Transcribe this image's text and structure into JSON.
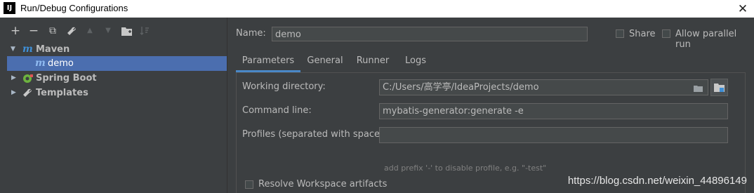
{
  "window": {
    "title": "Run/Debug Configurations",
    "app_icon": "IJ",
    "close": "✕"
  },
  "toolbar": {
    "add": "+",
    "remove": "−",
    "copy": "⧉",
    "edit": "🔧",
    "up": "▲",
    "down": "▼",
    "folder": "▣",
    "sort": "↓"
  },
  "tree": {
    "maven": {
      "label": "Maven",
      "icon": "m"
    },
    "demo": {
      "label": "demo",
      "icon": "m"
    },
    "spring_boot": {
      "label": "Spring Boot"
    },
    "templates": {
      "label": "Templates"
    }
  },
  "name": {
    "label": "Name:",
    "value": "demo"
  },
  "options": {
    "share": "Share",
    "allow_parallel": "Allow parallel run"
  },
  "tabs": [
    "Parameters",
    "General",
    "Runner",
    "Logs"
  ],
  "params": {
    "working_dir": {
      "label": "Working directory:",
      "value": "C:/Users/高学亭/IdeaProjects/demo"
    },
    "command_line": {
      "label": "Command line:",
      "value": "mybatis-generator:generate -e"
    },
    "profiles": {
      "label": "Profiles (separated with space):",
      "value": "",
      "hint": "add prefix '-' to disable profile, e.g. \"-test\""
    },
    "resolve": {
      "label": "Resolve Workspace artifacts"
    }
  },
  "watermark": "https://blog.csdn.net/weixin_44896149",
  "colors": {
    "selection": "#4b6eaf",
    "background": "#3c3f41",
    "tab_underline": "#4a88c7",
    "maven_icon": "#3f8fd6"
  }
}
